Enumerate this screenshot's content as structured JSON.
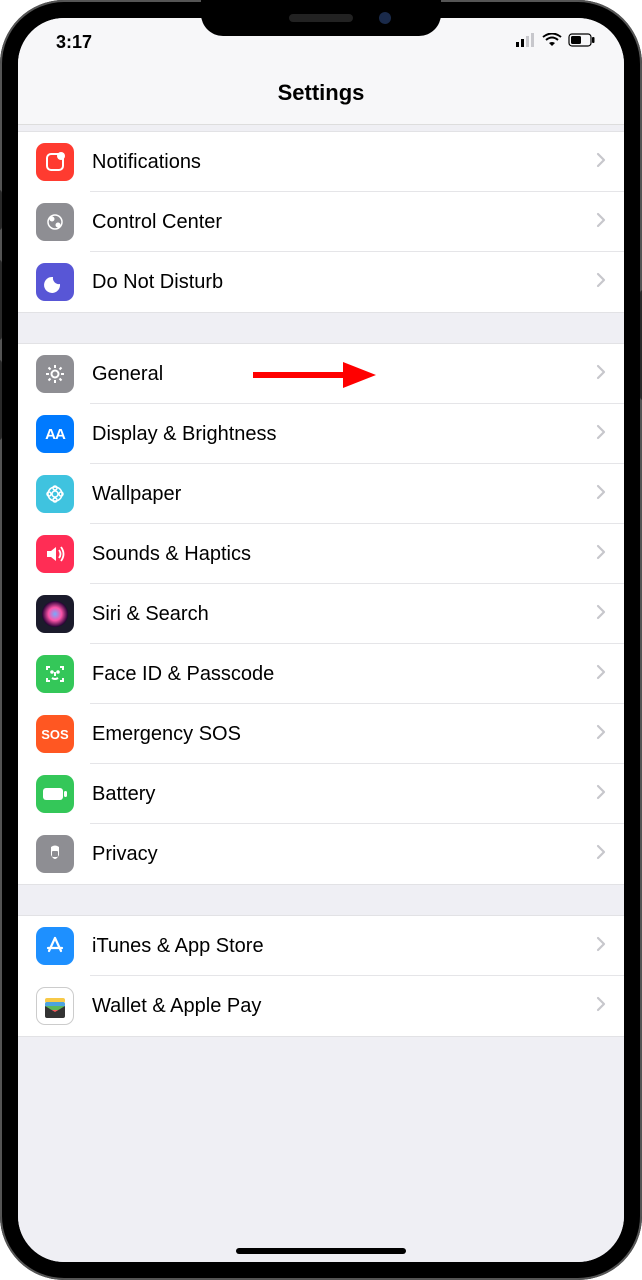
{
  "status_bar": {
    "time": "3:17"
  },
  "header": {
    "title": "Settings"
  },
  "groups": [
    {
      "items": [
        {
          "id": "notifications",
          "label": "Notifications",
          "icon": "notifications-icon",
          "bg": "#ff3b30"
        },
        {
          "id": "control-center",
          "label": "Control Center",
          "icon": "control-center-icon",
          "bg": "#8e8e93"
        },
        {
          "id": "do-not-disturb",
          "label": "Do Not Disturb",
          "icon": "do-not-disturb-icon",
          "bg": "#5856d6"
        }
      ]
    },
    {
      "items": [
        {
          "id": "general",
          "label": "General",
          "icon": "general-icon",
          "bg": "#8e8e93"
        },
        {
          "id": "display-brightness",
          "label": "Display & Brightness",
          "icon": "display-icon",
          "bg": "#007aff"
        },
        {
          "id": "wallpaper",
          "label": "Wallpaper",
          "icon": "wallpaper-icon",
          "bg": "#3fc3df"
        },
        {
          "id": "sounds-haptics",
          "label": "Sounds & Haptics",
          "icon": "sounds-icon",
          "bg": "#ff2d55"
        },
        {
          "id": "siri-search",
          "label": "Siri & Search",
          "icon": "siri-icon",
          "bg": "#1b1b2b"
        },
        {
          "id": "face-id-passcode",
          "label": "Face ID & Passcode",
          "icon": "faceid-icon",
          "bg": "#34c759"
        },
        {
          "id": "emergency-sos",
          "label": "Emergency SOS",
          "icon": "sos-icon",
          "bg": "#ff5722",
          "text": "SOS"
        },
        {
          "id": "battery",
          "label": "Battery",
          "icon": "battery-icon",
          "bg": "#34c759"
        },
        {
          "id": "privacy",
          "label": "Privacy",
          "icon": "privacy-icon",
          "bg": "#8e8e93"
        }
      ]
    },
    {
      "items": [
        {
          "id": "itunes-app-store",
          "label": "iTunes & App Store",
          "icon": "appstore-icon",
          "bg": "#1e90ff"
        },
        {
          "id": "wallet-apple-pay",
          "label": "Wallet & Apple Pay",
          "icon": "wallet-icon",
          "bg": "#000000"
        }
      ]
    }
  ],
  "annotation": {
    "target": "general"
  }
}
